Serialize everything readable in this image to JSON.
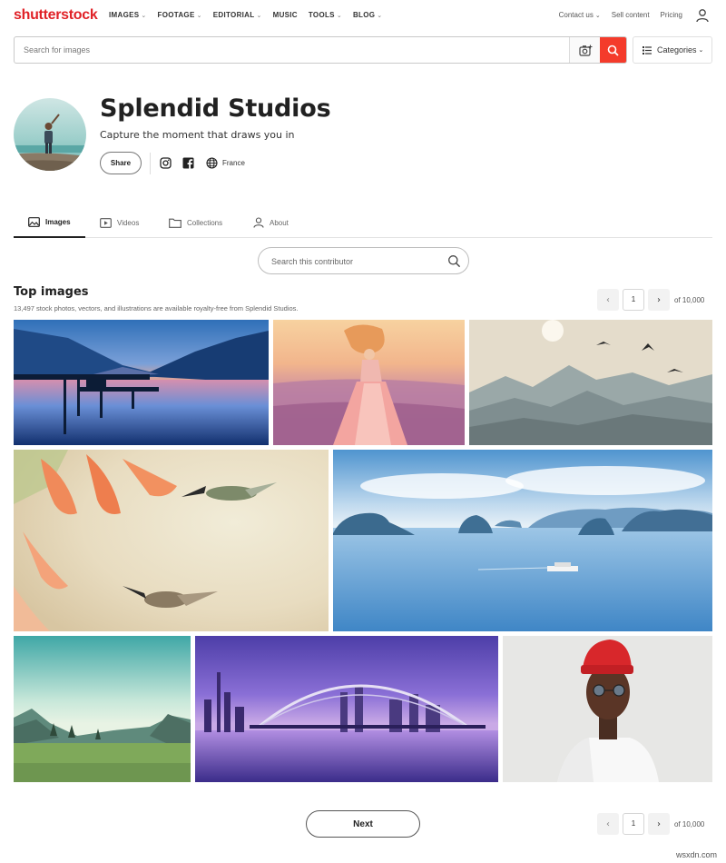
{
  "nav": {
    "logo_part1": "shutter",
    "logo_part2": "stock",
    "links": [
      {
        "label": "IMAGES",
        "has_dropdown": true
      },
      {
        "label": "FOOTAGE",
        "has_dropdown": true
      },
      {
        "label": "EDITORIAL",
        "has_dropdown": true
      },
      {
        "label": "MUSIC",
        "has_dropdown": false
      },
      {
        "label": "TOOLS",
        "has_dropdown": true
      },
      {
        "label": "BLOG",
        "has_dropdown": true
      }
    ],
    "contact_label": "Contact us",
    "sell_label": "Sell content",
    "pricing_label": "Pricing"
  },
  "search": {
    "placeholder": "Search for images",
    "categories_label": "Categories",
    "accent_color": "#f43b2b"
  },
  "profile": {
    "name": "Splendid Studios",
    "tagline": "Capture the moment that draws you in",
    "share_label": "Share",
    "country": "France",
    "social_icons": [
      "instagram-icon",
      "facebook-icon",
      "globe-icon"
    ]
  },
  "tabs": [
    {
      "label": "Images",
      "icon": "image-icon",
      "active": true
    },
    {
      "label": "Videos",
      "icon": "video-icon",
      "active": false
    },
    {
      "label": "Collections",
      "icon": "folder-icon",
      "active": false
    },
    {
      "label": "About",
      "icon": "person-icon",
      "active": false
    }
  ],
  "contributor_search": {
    "placeholder": "Search this contributor"
  },
  "top_images": {
    "title": "Top images",
    "subtitle": "13,497 stock photos, vectors, and illustrations are available royalty-free from Splendid Studios.",
    "pager": {
      "current_page": "1",
      "of_label": "of 10,000"
    }
  },
  "images": [
    {
      "subject": "lake-pier-sunset"
    },
    {
      "subject": "girl-in-lavender-field"
    },
    {
      "subject": "misty-mountains-birds"
    },
    {
      "subject": "hummingbirds-flowers"
    },
    {
      "subject": "halong-bay-boat"
    },
    {
      "subject": "mountain-meadow"
    },
    {
      "subject": "dubai-bridge-purple"
    },
    {
      "subject": "man-red-beanie"
    }
  ],
  "bottom": {
    "next_label": "Next",
    "current_page": "1",
    "of_label": "of 10,000"
  },
  "watermark": "wsxdn.com"
}
